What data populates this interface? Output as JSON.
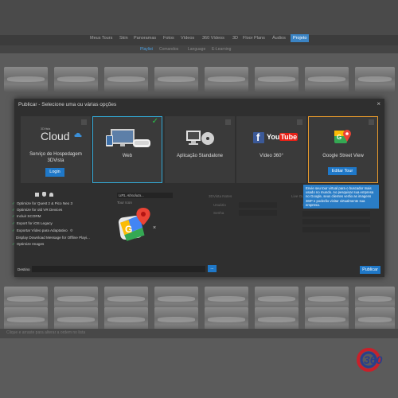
{
  "nav": {
    "tabs": [
      "Meus Tours",
      "Skin",
      "Panoramas",
      "Fotos",
      "Vídeos",
      "360 Vídeos",
      "3D",
      "Floor Plans",
      "Áudios",
      "Projeto"
    ],
    "active": "Projeto"
  },
  "subnav": {
    "tabs": [
      "Playlist",
      "Comandos",
      "Language",
      "E-Learning"
    ],
    "active": "Playlist"
  },
  "modal": {
    "title": "Publicar - Selecione uma ou várias opções",
    "close": "×",
    "cards": {
      "cloud": {
        "brand": "3DVista",
        "logo_text": "Cloud",
        "label_line1": "Serviço de Hospedagem",
        "label_line2": "3DVista",
        "button": "Login"
      },
      "web": {
        "label": "Web",
        "checked_icon": "✓"
      },
      "standalone": {
        "label": "Aplicação Standalone"
      },
      "video360": {
        "label": "Vídeo 360°",
        "logo_facebook": "f",
        "logo_youtube": "You",
        "logo_tube": "Tube"
      },
      "streetview": {
        "label": "Google Street View",
        "button": "Editar Tour"
      }
    },
    "options": [
      "Optimize for Quest 2 & Pico Neo 3",
      "Optimize for old VR Devices",
      "Incluir SCORM",
      "Export for iOS Legacy",
      "Exportar Vídeo para Adaptativo",
      "Display Download Message for Offline Playi...",
      "Optimize Images"
    ],
    "url_field": "URL Absoluta...",
    "tour_icon_label": "Tour Icon",
    "dimmed": {
      "notes": "3DVista Notes",
      "usuario": "Usuário",
      "senha": "Senha",
      "live": "Live Gu",
      "servidor": "Servid"
    },
    "tooltip": "Envie seu tour virtual para o buscador mais usado no mundo. Ao pesquisar sua empresa no Google, seus clientes verão as imagens 360º e poderão visitar virtualmente sua empresa.",
    "destino_label": "Destino",
    "browse_button": "...",
    "publish_button": "Publicar"
  },
  "footer": {
    "text": "Clique e arraste para alterar a ordem no lista"
  },
  "colors": {
    "accent": "#1f78c8",
    "selected_border": "#33a9d6",
    "highlight_border": "#e89a2c",
    "check_green": "#28c34a"
  }
}
